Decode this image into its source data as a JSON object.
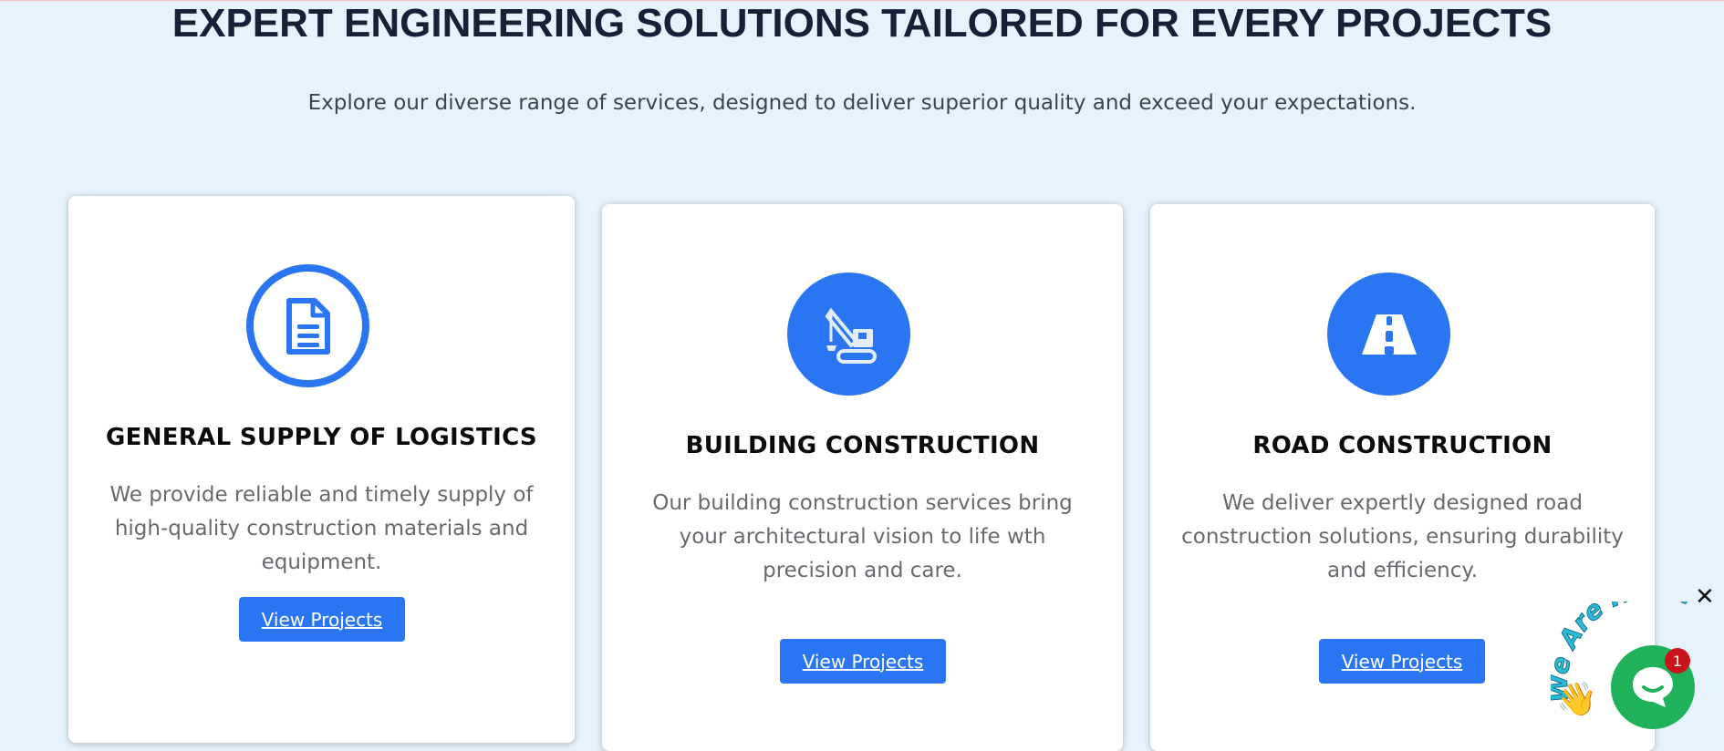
{
  "header": {
    "title": "EXPERT ENGINEERING SOLUTIONS TAILORED FOR EVERY PROJECTS",
    "subtitle": "Explore our diverse range of services, designed to deliver superior quality and exceed your expectations."
  },
  "services": [
    {
      "icon": "document-icon",
      "title": "GENERAL SUPPLY OF LOGISTICS",
      "description": "We provide reliable and timely supply of high-quality construction materials and equipment.",
      "button_label": "View Projects"
    },
    {
      "icon": "crane-icon",
      "title": "BUILDING CONSTRUCTION",
      "description": "Our building construction services bring your architectural vision to life wth precision and care.",
      "button_label": "View Projects"
    },
    {
      "icon": "road-icon",
      "title": "ROAD CONSTRUCTION",
      "description": "We deliver expertly designed road construction solutions, ensuring durability and efficiency.",
      "button_label": "View Projects"
    }
  ],
  "chat_widget": {
    "banner_text": "We Are Here!",
    "badge_count": "1",
    "close_label": "✕",
    "hand_emoji": "👋"
  },
  "colors": {
    "accent": "#2a76f2",
    "chat_green": "#1fb25a",
    "badge_red": "#c9141b",
    "background": "#e6f3fd"
  }
}
